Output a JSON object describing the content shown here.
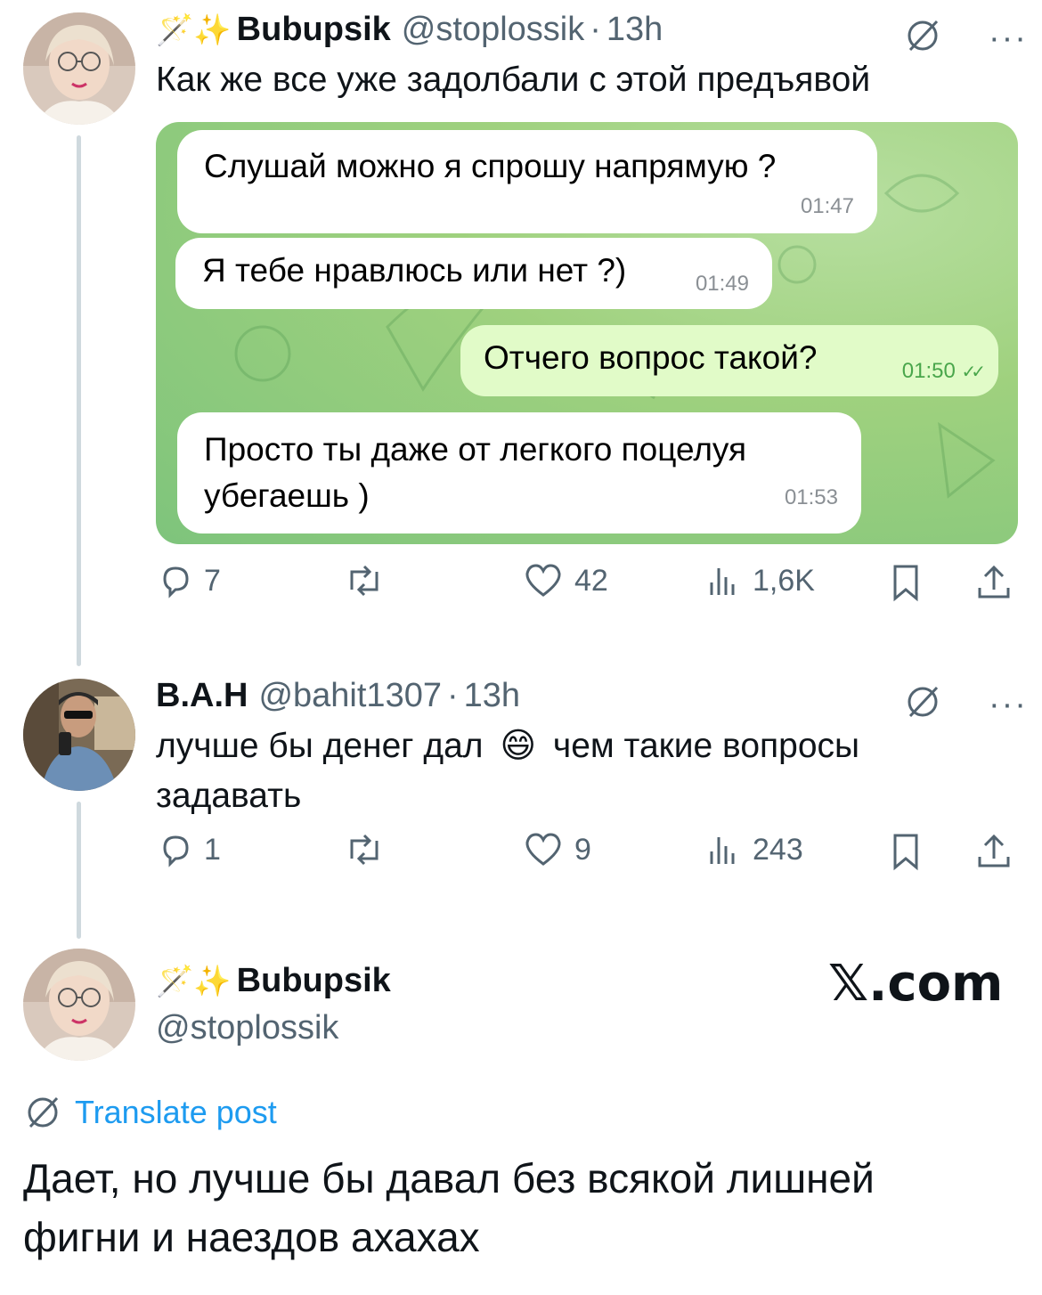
{
  "tweet1": {
    "deco": "🪄✨",
    "name": "Bubupsik",
    "handle": "@stoplossik",
    "sep": "·",
    "time": "13h",
    "text": "Как же все уже задолбали с этой предъявой",
    "chat": [
      {
        "text": "Слушай можно я спрошу напрямую ?",
        "time": "01:47",
        "dir": "in"
      },
      {
        "text": "Я тебе нравлюсь или нет ?)",
        "time": "01:49",
        "dir": "in"
      },
      {
        "text": "Отчего вопрос такой?",
        "time": "01:50",
        "dir": "out",
        "status": "✓✓"
      },
      {
        "text": "Просто ты даже от легкого поцелуя убегаешь )",
        "time": "01:53",
        "dir": "in"
      }
    ],
    "replies": "7",
    "likes": "42",
    "views": "1,6K"
  },
  "tweet2": {
    "name": "B.A.H",
    "handle": "@bahit1307",
    "sep": "·",
    "time": "13h",
    "text_line1": "лучше бы денег дал",
    "emoji": "😄",
    "text_line1b": "чем такие вопросы",
    "text_line2": "задавать",
    "replies": "1",
    "likes": "9",
    "views": "243"
  },
  "tweet3": {
    "deco": "🪄✨",
    "name": "Bubupsik",
    "handle": "@stoplossik",
    "brand": "𝕏.com",
    "translate": "Translate post",
    "text_line1": "Дает, но лучше бы давал без всякой лишней",
    "text_line2": "фигни и наездов ахахах"
  },
  "colors": {
    "link": "#1d9bf0",
    "muted": "#536471",
    "chat_green": "#8fcd7e",
    "bubble_out": "#e1fbc8"
  }
}
